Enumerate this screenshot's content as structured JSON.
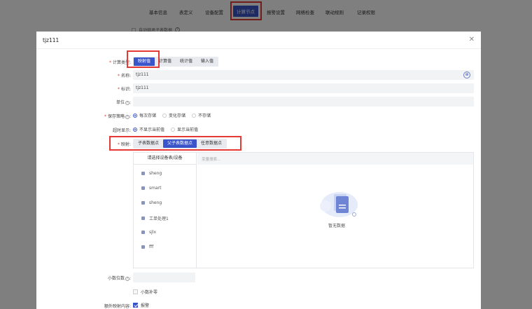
{
  "bg": {
    "tabs": [
      {
        "label": "基本信息"
      },
      {
        "label": "表定义"
      },
      {
        "label": "设备配置"
      },
      {
        "label": "计算节点"
      },
      {
        "label": "报警设置"
      },
      {
        "label": "网络检查"
      },
      {
        "label": "联动规则"
      },
      {
        "label": "记录权限"
      }
    ],
    "active_tab": "计算节点",
    "checkbox_label": "自动继承子表数据"
  },
  "dialog": {
    "title": "tjz111",
    "calc_type": {
      "label": "计算类型",
      "options": [
        "映射值",
        "计算值",
        "统计值",
        "输入值"
      ],
      "selected": "映射值"
    },
    "name": {
      "label": "名称",
      "value": "tjz111"
    },
    "ident": {
      "label": "标识",
      "value": "tjz111"
    },
    "unit": {
      "label": "单位",
      "value": ""
    },
    "save_policy": {
      "label": "保存策略",
      "options": [
        "每次存储",
        "变化存储",
        "不存储"
      ],
      "selected": "每次存储"
    },
    "timeout": {
      "label": "超时显示",
      "options": [
        "不显示当前值",
        "显示当前值"
      ],
      "selected": "不显示当前值"
    },
    "mapping": {
      "label": "映射",
      "options": [
        "子表数据点",
        "父子表数据点",
        "任意数据点"
      ],
      "selected": "父子表数据点",
      "left_header": "请选择设备表/设备",
      "search_placeholder": "变量搜索...",
      "devices": [
        "sheng",
        "smart",
        "sheng",
        "工单处理1",
        "sjlx",
        "fff"
      ],
      "empty_text": "暂无数据"
    },
    "decimals": {
      "label": "小数位数",
      "value": ""
    },
    "pad_zero": {
      "label": "小数补零",
      "checked": false
    },
    "extra": {
      "label": "额外映射内容",
      "option": "报警",
      "checked": true
    }
  },
  "colors": {
    "accent": "#3a55c9",
    "highlight": "#e53935"
  }
}
